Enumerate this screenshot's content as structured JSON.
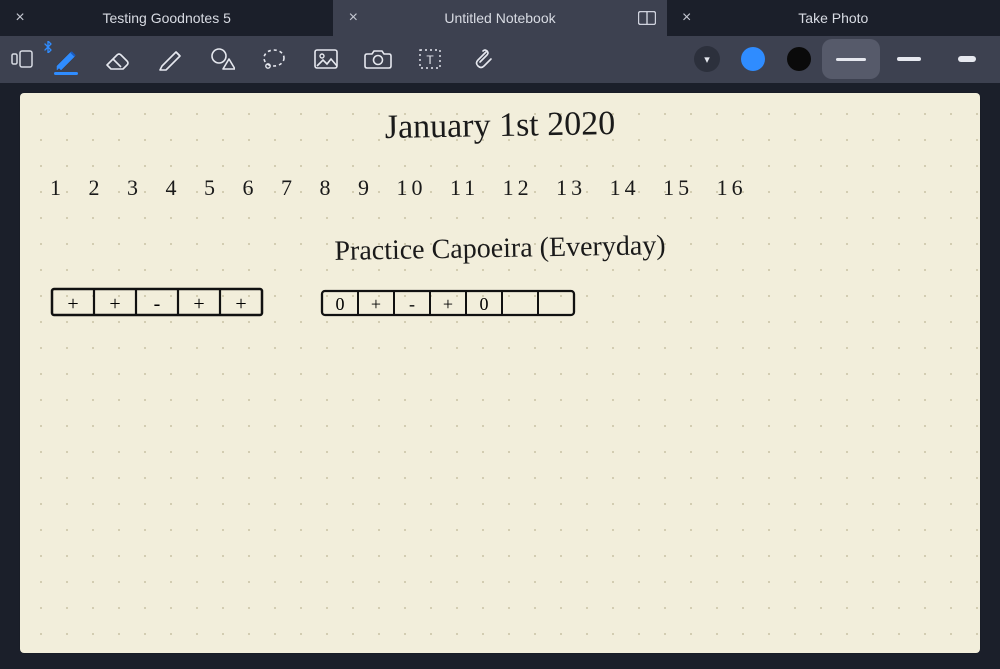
{
  "tabs": [
    {
      "label": "Testing Goodnotes 5",
      "active": false
    },
    {
      "label": "Untitled Notebook",
      "active": true
    },
    {
      "label": "Take Photo",
      "active": false
    }
  ],
  "toolbar": {
    "tools": [
      {
        "name": "page-thumbnails",
        "icon": "thumbnails"
      },
      {
        "name": "pen",
        "icon": "pen",
        "active": true,
        "bluetooth": true
      },
      {
        "name": "eraser",
        "icon": "eraser"
      },
      {
        "name": "highlighter",
        "icon": "highlighter"
      },
      {
        "name": "shape",
        "icon": "shape"
      },
      {
        "name": "lasso",
        "icon": "lasso"
      },
      {
        "name": "image",
        "icon": "image"
      },
      {
        "name": "camera",
        "icon": "camera"
      },
      {
        "name": "textbox",
        "icon": "textbox"
      },
      {
        "name": "link-attachment",
        "icon": "paperclip"
      }
    ],
    "color_dropdown": "▾",
    "colors": [
      {
        "name": "blue",
        "hex": "#2f8cff",
        "selected": true
      },
      {
        "name": "black",
        "hex": "#0a0a0a",
        "selected": false
      }
    ],
    "strokes": [
      {
        "name": "thin",
        "height": 3,
        "width": 30,
        "selected": true
      },
      {
        "name": "medium",
        "height": 4,
        "width": 24,
        "selected": false
      },
      {
        "name": "thick",
        "height": 6,
        "width": 18,
        "selected": false
      }
    ]
  },
  "page": {
    "title": "January 1st 2020",
    "numbers": "1  2  3  4  5  6  7   8  9   10  11   12  13  14  15  16",
    "subtitle": "Practice Capoeira (Everyday)",
    "tracker_a": [
      "+",
      "+",
      "-",
      "+",
      "+"
    ],
    "tracker_b": [
      "0",
      "+",
      "-",
      "+",
      "0",
      "",
      ""
    ]
  }
}
